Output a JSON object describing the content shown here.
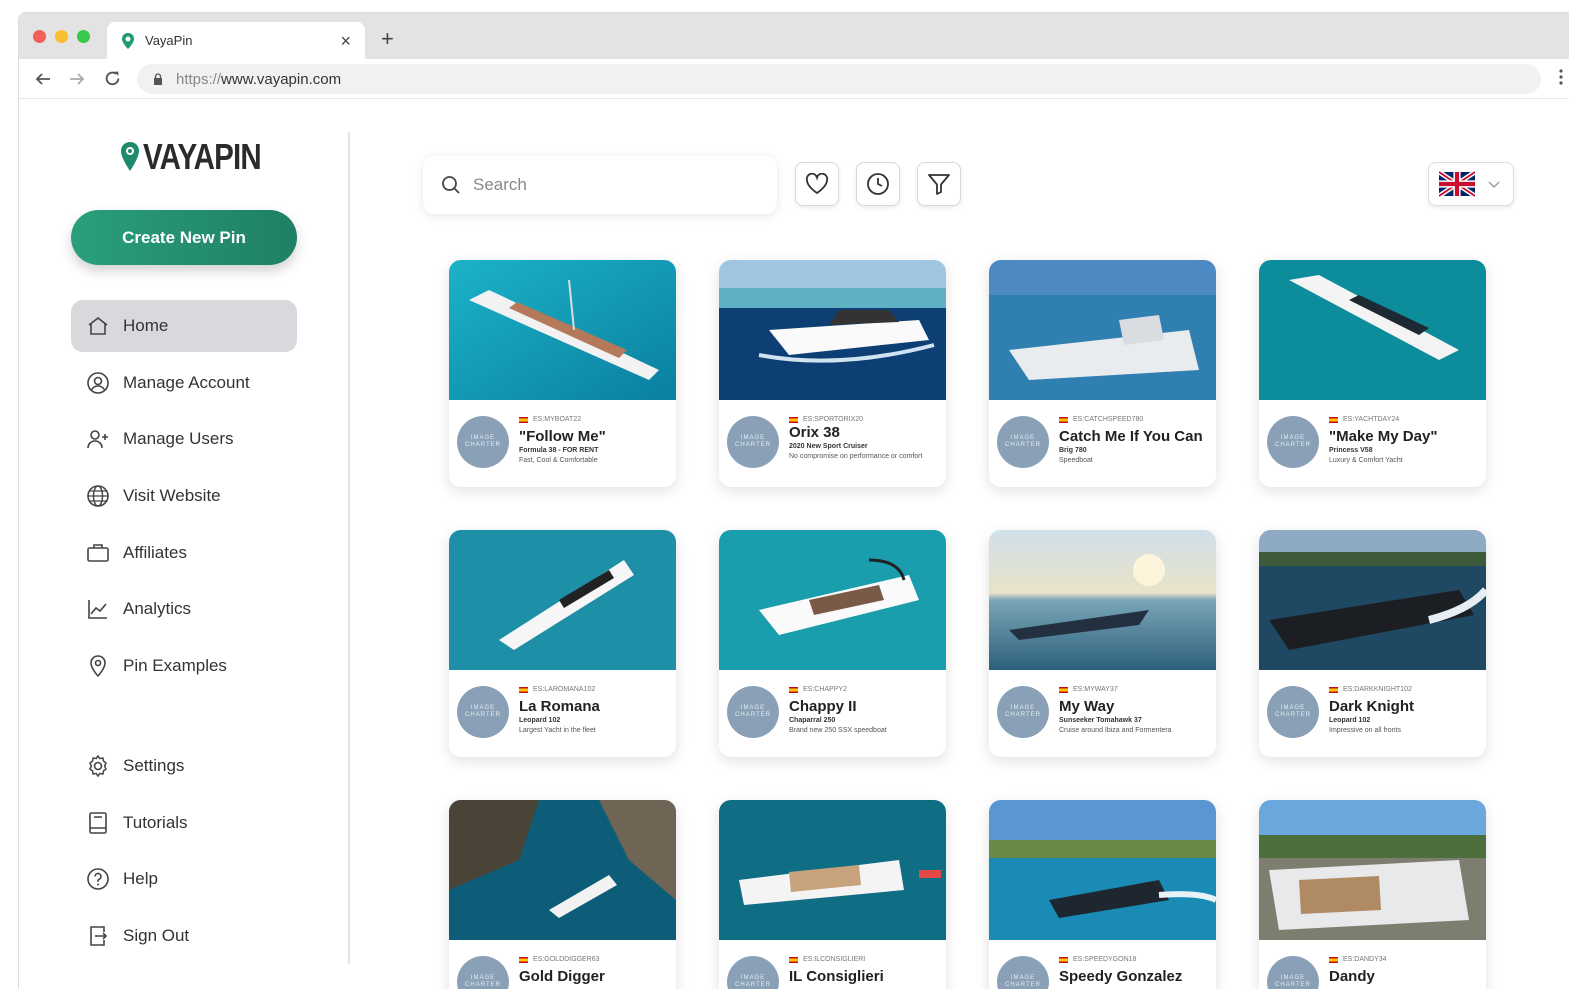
{
  "browser": {
    "tab_title": "VayaPin",
    "url_scheme": "https://",
    "url_host": "www.vayapin.com",
    "new_tab": "+",
    "close_tab": "×"
  },
  "brand": {
    "logo_text": "VAYAPIN",
    "accent": "#1f8a6c"
  },
  "sidebar": {
    "create_button": "Create New Pin",
    "items": [
      {
        "label": "Home",
        "icon": "home-icon",
        "active": true
      },
      {
        "label": "Manage Account",
        "icon": "account-icon"
      },
      {
        "label": "Manage Users",
        "icon": "add-user-icon"
      },
      {
        "label": "Visit Website",
        "icon": "globe-icon"
      },
      {
        "label": "Affiliates",
        "icon": "briefcase-icon"
      },
      {
        "label": "Analytics",
        "icon": "chart-icon"
      },
      {
        "label": "Pin Examples",
        "icon": "pin-icon"
      },
      {
        "label": "Settings",
        "icon": "gear-icon"
      },
      {
        "label": "Tutorials",
        "icon": "book-icon"
      },
      {
        "label": "Help",
        "icon": "help-icon"
      },
      {
        "label": "Sign Out",
        "icon": "sign-out-icon"
      }
    ]
  },
  "search": {
    "placeholder": "Search"
  },
  "toolbar_icons": [
    "heart-icon",
    "clock-icon",
    "filter-icon"
  ],
  "language": {
    "selected_flag": "uk-flag-icon"
  },
  "avatar_text": "IMAGE CHARTER",
  "cards": [
    {
      "code": "ES:MYBOAT22",
      "name": "\"Follow Me\"",
      "model": "Formula 38 - FOR RENT",
      "desc": "Fast, Cool & Comfortable"
    },
    {
      "code": "ES:SPORTORIX20",
      "name": "Orix 38",
      "model": "2020 New Sport Cruiser",
      "desc": "No compromise on performance or comfort"
    },
    {
      "code": "ES:CATCHSPEED780",
      "name": "Catch Me If You Can",
      "model": "Brig 780",
      "desc": "Speedboat"
    },
    {
      "code": "ES:YACHTDAY24",
      "name": "\"Make My Day\"",
      "model": "Princess V58",
      "desc": "Luxury & Comfort Yacht"
    },
    {
      "code": "ES:LAROMANA102",
      "name": "La Romana",
      "model": "Leopard 102",
      "desc": "Largest Yacht in the fleet"
    },
    {
      "code": "ES:CHAPPY2",
      "name": "Chappy II",
      "model": "Chaparral 250",
      "desc": "Brand new 250 SSX speedboat"
    },
    {
      "code": "ES:MYWAY37",
      "name": "My Way",
      "model": "Sunseeker Tomahawk 37",
      "desc": "Cruise around Ibiza and Formentera"
    },
    {
      "code": "ES:DARKKNIGHT102",
      "name": "Dark Knight",
      "model": "Leopard 102",
      "desc": "Impressive on all fronts"
    },
    {
      "code": "ES:GOLDDIGGER63",
      "name": "Gold Digger",
      "model": "",
      "desc": ""
    },
    {
      "code": "ES:ILCONSIGLIERI",
      "name": "IL Consiglieri",
      "model": "",
      "desc": ""
    },
    {
      "code": "ES:SPEEDYGON18",
      "name": "Speedy Gonzalez",
      "model": "",
      "desc": ""
    },
    {
      "code": "ES:DANDY34",
      "name": "Dandy",
      "model": "",
      "desc": ""
    }
  ]
}
